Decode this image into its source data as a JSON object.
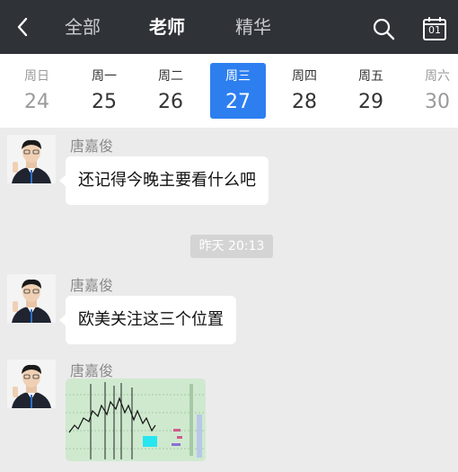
{
  "header": {
    "tabs": [
      "全部",
      "老师",
      "精华"
    ],
    "active_tab": "老师",
    "calendar_day": "01"
  },
  "dates": [
    {
      "weekday": "周日",
      "day": "24",
      "state": "faded"
    },
    {
      "weekday": "周一",
      "day": "25",
      "state": "normal"
    },
    {
      "weekday": "周二",
      "day": "26",
      "state": "normal"
    },
    {
      "weekday": "周三",
      "day": "27",
      "state": "active"
    },
    {
      "weekday": "周四",
      "day": "28",
      "state": "normal"
    },
    {
      "weekday": "周五",
      "day": "29",
      "state": "normal"
    },
    {
      "weekday": "周六",
      "day": "30",
      "state": "faded"
    }
  ],
  "messages": [
    {
      "sender": "唐嘉俊",
      "text": "还记得今晚主要看什么吧"
    },
    {
      "sender": "唐嘉俊",
      "text": "欧美关注这三个位置"
    },
    {
      "sender": "唐嘉俊",
      "image": "chart-image"
    }
  ],
  "timestamp": "昨天 20:13",
  "colors": {
    "header_bg": "#2f3237",
    "accent": "#2d7ff0",
    "chat_bg": "#ebebeb"
  }
}
